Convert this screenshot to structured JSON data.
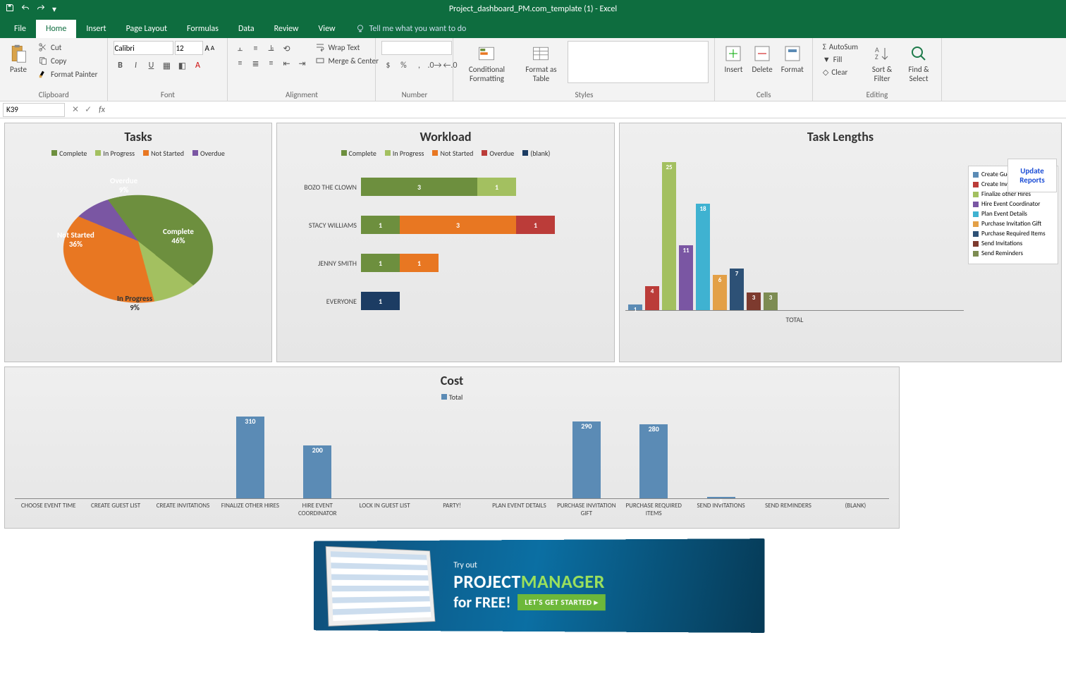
{
  "app": {
    "title": "Project_dashboard_PM.com_template (1) - Excel"
  },
  "tabs": [
    "File",
    "Home",
    "Insert",
    "Page Layout",
    "Formulas",
    "Data",
    "Review",
    "View"
  ],
  "active_tab": "Home",
  "tellme": "Tell me what you want to do",
  "ribbon": {
    "clipboard": {
      "label": "Clipboard",
      "paste": "Paste",
      "cut": "Cut",
      "copy": "Copy",
      "format_painter": "Format Painter"
    },
    "font": {
      "label": "Font",
      "name": "Calibri",
      "size": "12"
    },
    "alignment": {
      "label": "Alignment",
      "wrap": "Wrap Text",
      "merge": "Merge & Center"
    },
    "number": {
      "label": "Number"
    },
    "styles": {
      "label": "Styles",
      "cond": "Conditional Formatting",
      "table": "Format as Table"
    },
    "cells": {
      "label": "Cells",
      "insert": "Insert",
      "delete": "Delete",
      "format": "Format"
    },
    "editing": {
      "label": "Editing",
      "autosum": "AutoSum",
      "fill": "Fill",
      "clear": "Clear",
      "sort": "Sort & Filter",
      "find": "Find & Select"
    }
  },
  "namebox": "K39",
  "formula": "",
  "update_button": "Update Reports",
  "colors": {
    "complete": "#6d8f3e",
    "in_progress": "#a3c060",
    "not_started": "#e87722",
    "overdue": "#bb3c39",
    "blank": "#1c3c63",
    "purple": "#7a56a3",
    "cyan": "#3fb2d1",
    "tan": "#e3a047",
    "darkblue": "#2d5176",
    "maroon": "#7d3a2e",
    "olive": "#7d8c52",
    "costblue": "#5b8bb5"
  },
  "chart_data": {
    "tasks": {
      "type": "pie",
      "title": "Tasks",
      "legend": [
        "Complete",
        "In Progress",
        "Not Started",
        "Overdue"
      ],
      "series": [
        {
          "name": "Complete",
          "value": 46,
          "label": "Complete\n46%"
        },
        {
          "name": "In Progress",
          "value": 9,
          "label": "In Progress\n9%"
        },
        {
          "name": "Not Started",
          "value": 36,
          "label": "Not Started\n36%"
        },
        {
          "name": "Overdue",
          "value": 9,
          "label": "Overdue\n9%"
        }
      ]
    },
    "workload": {
      "type": "bar",
      "orientation": "horizontal",
      "stacked": true,
      "title": "Workload",
      "legend": [
        "Complete",
        "In Progress",
        "Not Started",
        "Overdue",
        "(blank)"
      ],
      "categories": [
        "BOZO THE CLOWN",
        "STACY WILLIAMS",
        "JENNY SMITH",
        "EVERYONE"
      ],
      "series": [
        {
          "name": "Complete",
          "color": "#6d8f3e",
          "values": [
            3,
            1,
            1,
            0
          ]
        },
        {
          "name": "In Progress",
          "color": "#a3c060",
          "values": [
            1,
            0,
            0,
            0
          ]
        },
        {
          "name": "Not Started",
          "color": "#e87722",
          "values": [
            0,
            3,
            1,
            0
          ]
        },
        {
          "name": "Overdue",
          "color": "#bb3c39",
          "values": [
            0,
            1,
            0,
            0
          ]
        },
        {
          "name": "(blank)",
          "color": "#1c3c63",
          "values": [
            0,
            0,
            0,
            1
          ]
        }
      ]
    },
    "task_lengths": {
      "type": "bar",
      "title": "Task Lengths",
      "xlabel": "TOTAL",
      "categories": [
        "Create Guest List",
        "Create Invitations",
        "Finalize other Hires",
        "Hire Event Coordinator",
        "Plan Event Details",
        "Purchase Invitation Gift",
        "Purchase Required Items",
        "Send Invitations",
        "Send Reminders"
      ],
      "values": [
        1,
        4,
        25,
        11,
        18,
        6,
        7,
        3,
        3
      ],
      "colors": [
        "#5b8bb5",
        "#bb3c39",
        "#a3c060",
        "#7a56a3",
        "#3fb2d1",
        "#e3a047",
        "#2d5176",
        "#7d3a2e",
        "#7d8c52"
      ]
    },
    "cost": {
      "type": "bar",
      "title": "Cost",
      "legend": [
        "Total"
      ],
      "categories": [
        "CHOOSE EVENT TIME",
        "CREATE GUEST LIST",
        "CREATE INVITATIONS",
        "FINALIZE OTHER HIRES",
        "HIRE EVENT COORDINATOR",
        "LOCK IN GUEST LIST",
        "PARTY!",
        "PLAN EVENT DETAILS",
        "PURCHASE INVITATION GIFT",
        "PURCHASE REQUIRED ITEMS",
        "SEND INVITATIONS",
        "SEND REMINDERS",
        "(BLANK)"
      ],
      "values": [
        0,
        0,
        0,
        310,
        200,
        0,
        0,
        0,
        290,
        280,
        5,
        0,
        0
      ],
      "ylim": [
        0,
        320
      ]
    }
  },
  "banner": {
    "line1": "Try out",
    "brand1": "PROJECT",
    "brand2": "MANAGER",
    "line3": "for FREE!",
    "cta": "LET'S GET STARTED ▸"
  }
}
